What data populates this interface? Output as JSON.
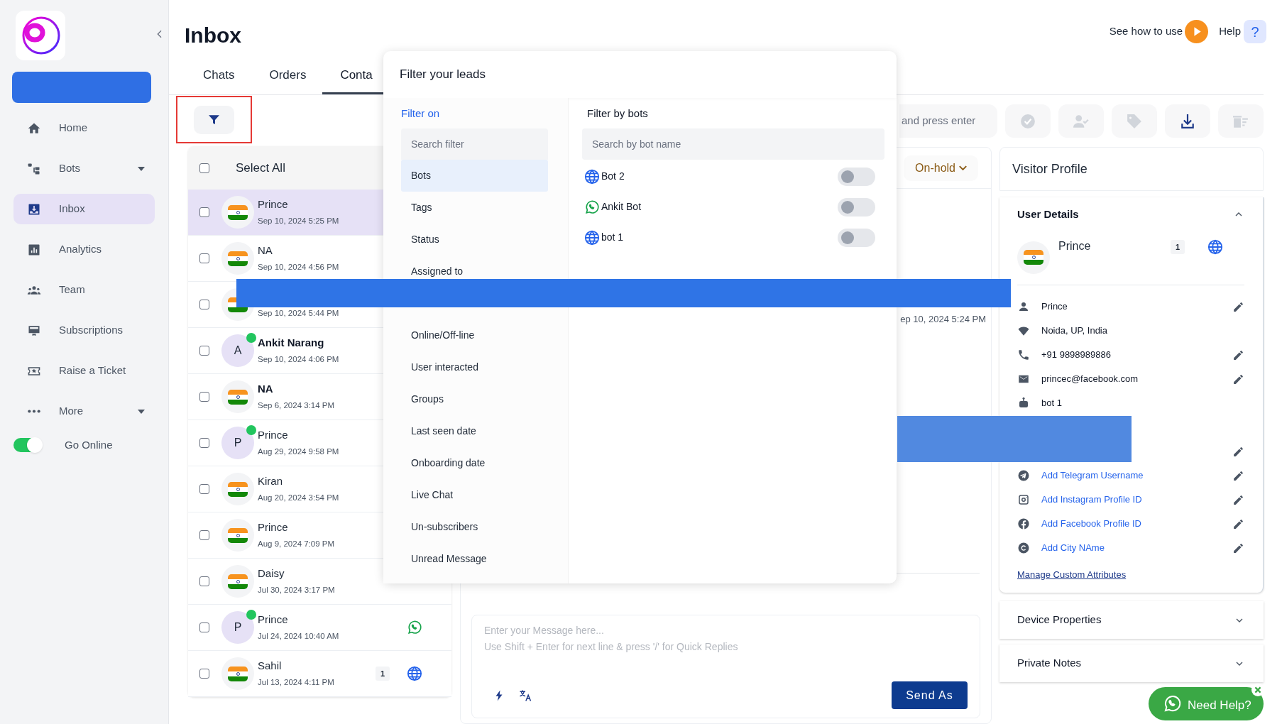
{
  "sidebar": {
    "items": [
      {
        "label": "Home",
        "selected": false,
        "expandable": false
      },
      {
        "label": "Bots",
        "selected": false,
        "expandable": true
      },
      {
        "label": "Inbox",
        "selected": true,
        "expandable": false
      },
      {
        "label": "Analytics",
        "selected": false,
        "expandable": false
      },
      {
        "label": "Team",
        "selected": false,
        "expandable": false
      },
      {
        "label": "Subscriptions",
        "selected": false,
        "expandable": false
      },
      {
        "label": "Raise a Ticket",
        "selected": false,
        "expandable": false
      },
      {
        "label": "More",
        "selected": false,
        "expandable": true
      }
    ],
    "go_online": {
      "label": "Go Online",
      "on": true
    }
  },
  "header": {
    "title": "Inbox",
    "how_to": "See how to use",
    "help": "Help",
    "help_glyph": "?"
  },
  "tabs": [
    {
      "label": "Chats",
      "selected": false
    },
    {
      "label": "Orders",
      "selected": false
    },
    {
      "label": "Conta",
      "selected": true
    }
  ],
  "contacts": {
    "select_all": {
      "label": "Select All",
      "checked": false
    },
    "rows": [
      {
        "kind": "flag",
        "name": "Prince",
        "bold": false,
        "time": "Sep 10, 2024 5:25 PM",
        "online": false,
        "selected": true,
        "checked": false
      },
      {
        "kind": "flag",
        "name": "NA",
        "bold": false,
        "time": "Sep 10, 2024 4:56 PM",
        "online": false,
        "selected": false,
        "checked": false
      },
      {
        "kind": "flag",
        "time": "Sep 10, 2024 5:44 PM",
        "online": false,
        "selected": false,
        "checked": false
      },
      {
        "kind": "letter",
        "name": "Ankit Narang",
        "bold": true,
        "time": "Sep 10, 2024 4:06 PM",
        "letter": "A",
        "online": true,
        "selected": false,
        "checked": false
      },
      {
        "kind": "flag",
        "name": "NA",
        "bold": true,
        "time": "Sep 6, 2024 3:14 PM",
        "online": false,
        "selected": false,
        "checked": false
      },
      {
        "kind": "letter",
        "name": "Prince",
        "bold": false,
        "time": "Aug 29, 2024 9:58 PM",
        "letter": "P",
        "online": true,
        "selected": false,
        "checked": false
      },
      {
        "kind": "flag",
        "name": "Kiran",
        "bold": false,
        "time": "Aug 20, 2024 3:54 PM",
        "online": false,
        "selected": false,
        "checked": false
      },
      {
        "kind": "flag",
        "name": "Prince",
        "bold": false,
        "time": "Aug 9, 2024 7:09 PM",
        "online": false,
        "selected": false,
        "checked": false
      },
      {
        "kind": "flag",
        "name": "Daisy",
        "bold": false,
        "time": "Jul 30, 2024 3:17 PM",
        "online": false,
        "selected": false,
        "checked": false
      },
      {
        "kind": "letter",
        "name": "Prince",
        "bold": false,
        "time": "Jul 24, 2024 10:40 AM",
        "letter": "P",
        "online": true,
        "selected": false,
        "checked": false,
        "channel": {
          "kind": "whatsapp"
        }
      },
      {
        "kind": "flag",
        "name": "Sahil",
        "bold": false,
        "time": "Jul 13, 2024 4:11 PM",
        "online": false,
        "selected": false,
        "checked": false,
        "badge": "1",
        "channel": {
          "kind": "web"
        }
      }
    ]
  },
  "toolbar": {
    "search_placeholder": "and press enter",
    "buttons": [
      {
        "kind": "check",
        "disabled": true
      },
      {
        "kind": "assign",
        "disabled": true
      },
      {
        "kind": "tag",
        "disabled": true
      },
      {
        "kind": "download",
        "disabled": false
      },
      {
        "kind": "delete",
        "disabled": true
      }
    ]
  },
  "chat": {
    "status": "On-hold",
    "time": "ep 10, 2024 5:24 PM",
    "composer": {
      "placeholder": "Enter your Message here...\nUse Shift + Enter for next line & press '/' for Quick Replies",
      "send": "Send As"
    }
  },
  "profile": {
    "title": "Visitor Profile",
    "user_details": {
      "title": "User Details",
      "expanded": true,
      "name": "Prince",
      "badge": "1",
      "fields": [
        {
          "kind": "value",
          "text": "Prince",
          "editable": true
        },
        {
          "kind": "value",
          "text": "Noida, UP, India",
          "editable": false
        },
        {
          "kind": "value",
          "text": "+91 9898989886",
          "editable": true
        },
        {
          "kind": "value",
          "text": "princec@facebook.com",
          "editable": true
        },
        {
          "kind": "value",
          "text": "bot 1",
          "editable": false
        },
        {
          "kind": "covered"
        },
        {
          "kind": "covered",
          "editable": true
        },
        {
          "kind": "link",
          "text": "Add Telegram Username",
          "editable": true
        },
        {
          "kind": "link",
          "text": "Add Instagram Profile ID",
          "editable": true
        },
        {
          "kind": "link",
          "text": "Add Facebook Profile ID",
          "editable": true
        },
        {
          "kind": "link",
          "text": "Add City NAme",
          "editable": true
        }
      ],
      "manage_link": "Manage Custom Attributes"
    },
    "sections": [
      {
        "title": "Device Properties",
        "expanded": false
      },
      {
        "title": "Private Notes",
        "expanded": false
      }
    ]
  },
  "filter_popup": {
    "title": "Filter your leads",
    "left_title": "Filter on",
    "search_placeholder": "Search filter",
    "items": [
      {
        "kind": "item",
        "label": "Bots",
        "selected": true
      },
      {
        "kind": "item",
        "label": "Tags",
        "selected": false
      },
      {
        "kind": "item",
        "label": "Status",
        "selected": false
      },
      {
        "kind": "item",
        "label": "Assigned to",
        "selected": false
      },
      {
        "kind": "covered"
      },
      {
        "kind": "item",
        "label": "Online/Off-line",
        "selected": false
      },
      {
        "kind": "item",
        "label": "User interacted",
        "selected": false
      },
      {
        "kind": "item",
        "label": "Groups",
        "selected": false
      },
      {
        "kind": "item",
        "label": "Last seen date",
        "selected": false
      },
      {
        "kind": "item",
        "label": "Onboarding date",
        "selected": false
      },
      {
        "kind": "item",
        "label": "Live Chat",
        "selected": false
      },
      {
        "kind": "item",
        "label": "Un-subscribers",
        "selected": false
      },
      {
        "kind": "item",
        "label": "Unread Message",
        "selected": false
      }
    ],
    "right_title": "Filter by bots",
    "bot_search_placeholder": "Search by bot name",
    "bots": [
      {
        "kind": "web",
        "name": "Bot 2",
        "on": false
      },
      {
        "kind": "whatsapp",
        "name": "Ankit Bot",
        "on": false
      },
      {
        "kind": "web",
        "name": "bot 1",
        "on": false
      }
    ]
  },
  "help_widget": {
    "label": "Need Help?"
  }
}
